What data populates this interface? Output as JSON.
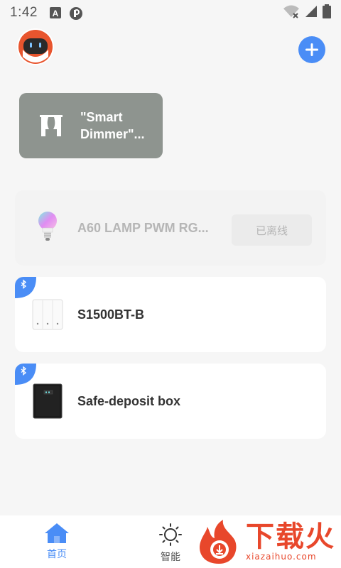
{
  "status_bar": {
    "time": "1:42",
    "icons": [
      "a-icon",
      "p-icon",
      "wifi-off-icon",
      "signal-icon",
      "battery-icon"
    ]
  },
  "header": {
    "avatar": "robot-avatar",
    "add_icon": "plus-icon"
  },
  "scene": {
    "label": "\"Smart\nDimmer\"...",
    "icon": "curtain-icon"
  },
  "devices": [
    {
      "name": "A60 LAMP PWM RG...",
      "status": "已离线",
      "icon": "bulb-icon",
      "offline": true
    },
    {
      "name": "S1500BT-B",
      "icon": "switch-icon",
      "bluetooth": true
    },
    {
      "name": "Safe-deposit box",
      "icon": "safe-icon",
      "bluetooth": true
    }
  ],
  "nav": [
    {
      "label": "首页",
      "icon": "home-icon",
      "active": true
    },
    {
      "label": "智能",
      "icon": "sun-icon",
      "active": false
    }
  ],
  "watermark": {
    "text": "下载火",
    "sub": "xiazaihuo.com"
  },
  "colors": {
    "accent": "#4a8df6",
    "scene_bg": "#8e948f",
    "watermark": "#e8472b"
  }
}
